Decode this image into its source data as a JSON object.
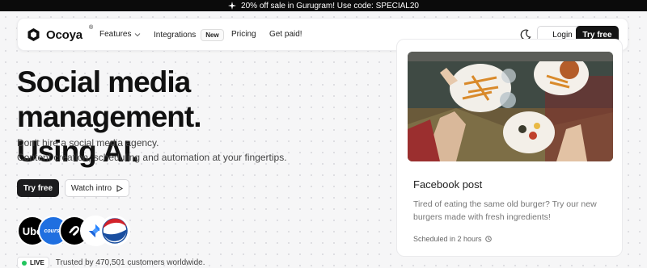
{
  "promo": {
    "text": "20% off sale in Gurugram! Use code: SPECIAL20"
  },
  "nav": {
    "brand": "Ocoya",
    "brand_mark": "®",
    "features": "Features",
    "integrations": "Integrations",
    "new_badge": "New",
    "pricing": "Pricing",
    "get_paid": "Get paid!",
    "login": "Login",
    "try_free": "Try free"
  },
  "hero": {
    "title_line1": "Social media management.",
    "title_line2": "Using AI.",
    "sub_line1": "Don't hire a social media agency.",
    "sub_line2": "Content creation, scheduling and automation at your fingertips.",
    "try_free": "Try free",
    "watch_intro": "Watch intro"
  },
  "customers": {
    "logos": [
      "Uber",
      "coursera",
      "Squarespace",
      "Jira",
      "Pepsi"
    ],
    "uber_text": "Ube",
    "coursera_text": "course",
    "live": "LIVE",
    "trusted": "Trusted by 470,501 customers worldwide."
  },
  "post_card": {
    "title": "Facebook post",
    "body": "Tired of eating the same old burger? Try our new burgers made with fresh ingredients!",
    "scheduled": "Scheduled in 2 hours"
  },
  "colors": {
    "accent_dark": "#141414",
    "live_green": "#22c55e",
    "pepsi_blue": "#1a4fa0",
    "pepsi_red": "#d3222a"
  },
  "icons": [
    "sparkle-icon",
    "ocoya-logo-icon",
    "chevron-down-icon",
    "moon-icon",
    "play-icon",
    "clock-icon"
  ]
}
